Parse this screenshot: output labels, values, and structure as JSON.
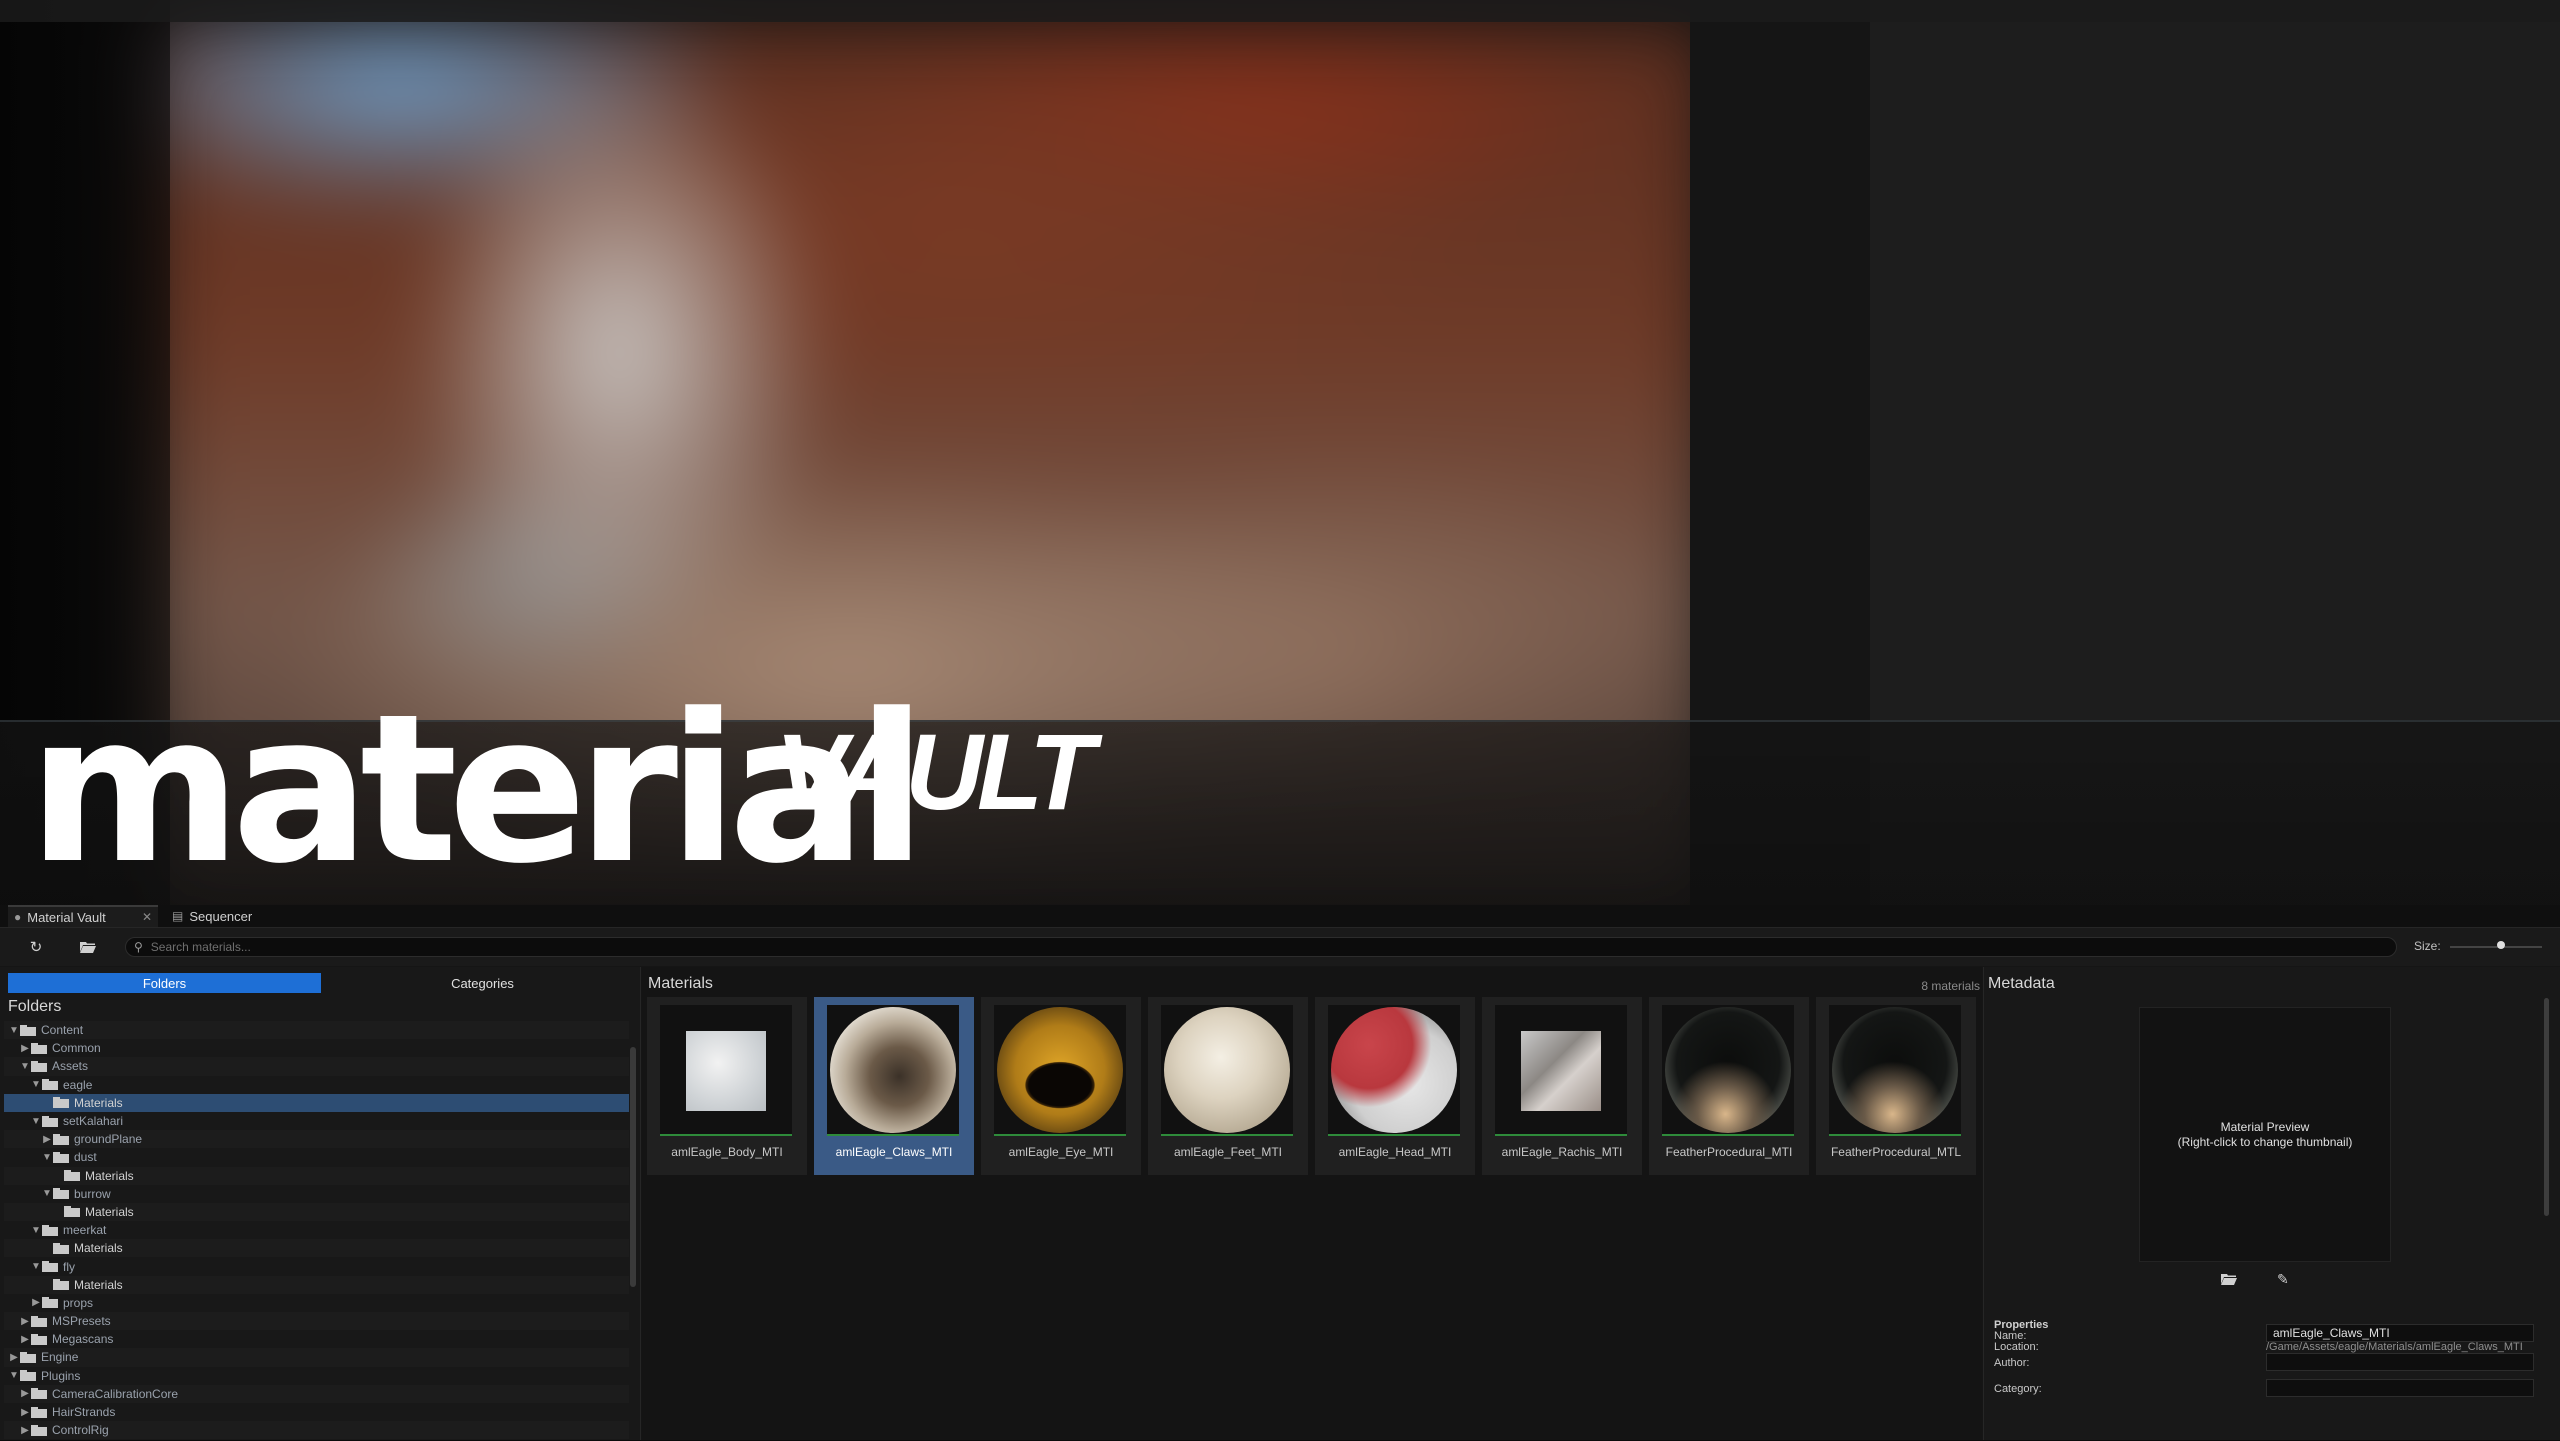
{
  "hero": {
    "title_main": "material",
    "title_sub": "VAULT"
  },
  "tabs": [
    {
      "label": "Material Vault",
      "icon": "material-vault-icon",
      "closable": true
    },
    {
      "label": "Sequencer",
      "icon": "sequencer-icon",
      "closable": false
    }
  ],
  "toolbar": {
    "refresh_icon": "refresh-icon",
    "open_icon": "folder-open-icon",
    "search_placeholder": "Search materials...",
    "size_label": "Size:",
    "size_value": 0.55
  },
  "left_panel": {
    "folders_button": "Folders",
    "categories_button": "Categories",
    "title": "Folders",
    "tree": [
      {
        "label": "Content",
        "level": 0,
        "expanded": true
      },
      {
        "label": "Common",
        "level": 1,
        "expanded": false
      },
      {
        "label": "Assets",
        "level": 1,
        "expanded": true
      },
      {
        "label": "eagle",
        "level": 2,
        "expanded": true
      },
      {
        "label": "Materials",
        "level": 3,
        "leaf": true,
        "selected": true
      },
      {
        "label": "setKalahari",
        "level": 2,
        "expanded": true
      },
      {
        "label": "groundPlane",
        "level": 3,
        "expanded": false
      },
      {
        "label": "dust",
        "level": 3,
        "expanded": true
      },
      {
        "label": "Materials",
        "level": 4,
        "leaf": true
      },
      {
        "label": "burrow",
        "level": 3,
        "expanded": true
      },
      {
        "label": "Materials",
        "level": 4,
        "leaf": true
      },
      {
        "label": "meerkat",
        "level": 2,
        "expanded": true
      },
      {
        "label": "Materials",
        "level": 3,
        "leaf": true
      },
      {
        "label": "fly",
        "level": 2,
        "expanded": true
      },
      {
        "label": "Materials",
        "level": 3,
        "leaf": true
      },
      {
        "label": "props",
        "level": 2,
        "expanded": false
      },
      {
        "label": "MSPresets",
        "level": 1,
        "expanded": false
      },
      {
        "label": "Megascans",
        "level": 1,
        "expanded": false
      },
      {
        "label": "Engine",
        "level": 0,
        "expanded": false
      },
      {
        "label": "Plugins",
        "level": 0,
        "expanded": true
      },
      {
        "label": "CameraCalibrationCore",
        "level": 1,
        "expanded": false
      },
      {
        "label": "HairStrands",
        "level": 1,
        "expanded": false
      },
      {
        "label": "ControlRig",
        "level": 1,
        "expanded": false
      }
    ]
  },
  "materials_panel": {
    "title": "Materials",
    "count": "8 materials",
    "items": [
      {
        "label": "amlEagle_Body_MTI",
        "selected": false
      },
      {
        "label": "amlEagle_Claws_MTI",
        "selected": true
      },
      {
        "label": "amlEagle_Eye_MTI",
        "selected": false
      },
      {
        "label": "amlEagle_Feet_MTI",
        "selected": false
      },
      {
        "label": "amlEagle_Head_MTI",
        "selected": false
      },
      {
        "label": "amlEagle_Rachis_MTI",
        "selected": false
      },
      {
        "label": "FeatherProcedural_MTI",
        "selected": false
      },
      {
        "label": "FeatherProcedural_MTL",
        "selected": false
      }
    ]
  },
  "metadata_panel": {
    "title": "Metadata",
    "preview_line1": "Material Preview",
    "preview_line2": "(Right-click to change thumbnail)",
    "open_icon": "folder-open-icon",
    "edit_icon": "pencil-icon",
    "properties_title": "Properties",
    "name_label": "Name:",
    "name_value": "amlEagle_Claws_MTI",
    "location_label": "Location:",
    "location_value": "/Game/Assets/eagle/Materials/amlEagle_Claws_MTI",
    "author_label": "Author:",
    "author_value": "",
    "category_label": "Category:",
    "category_value": ""
  },
  "colors": {
    "accent_blue": "#1e6fd6",
    "selection_blue": "#3a5a86",
    "tree_selection": "#2d4d73",
    "thumb_bar_green": "#2e8b3a"
  }
}
